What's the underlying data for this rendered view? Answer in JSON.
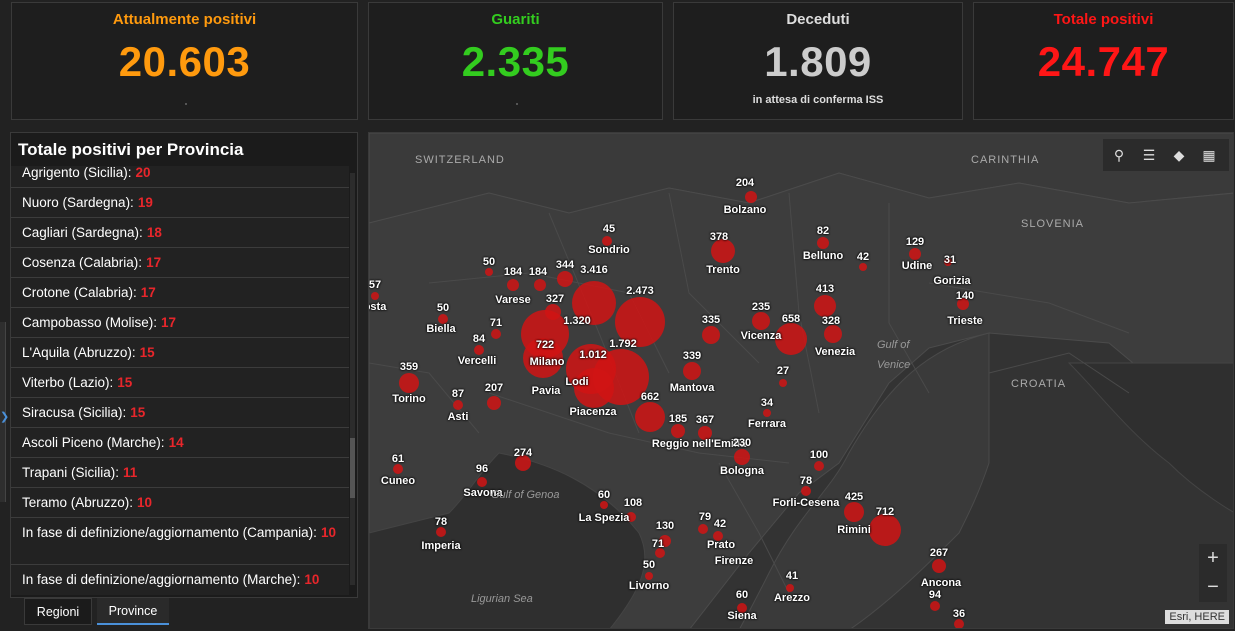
{
  "cards": {
    "active": {
      "title": "Attualmente positivi",
      "value": "20.603",
      "color": "#ff9a0e"
    },
    "recovered": {
      "title": "Guariti",
      "value": "2.335",
      "color": "#33cc1f"
    },
    "deceased": {
      "title": "Deceduti",
      "value": "1.809",
      "note": "in attesa di conferma ISS",
      "color": "#cccccc"
    },
    "total": {
      "title": "Totale positivi",
      "value": "24.747",
      "color": "#ff1616"
    }
  },
  "panel": {
    "title": "Totale positivi per Provincia",
    "rows": [
      {
        "label": "Agrigento (Sicilia):",
        "value": "20"
      },
      {
        "label": "Nuoro (Sardegna):",
        "value": "19"
      },
      {
        "label": "Cagliari (Sardegna):",
        "value": "18"
      },
      {
        "label": "Cosenza (Calabria):",
        "value": "17"
      },
      {
        "label": "Crotone (Calabria):",
        "value": "17"
      },
      {
        "label": "Campobasso (Molise):",
        "value": "17"
      },
      {
        "label": "L'Aquila (Abruzzo):",
        "value": "15"
      },
      {
        "label": "Viterbo (Lazio):",
        "value": "15"
      },
      {
        "label": "Siracusa (Sicilia):",
        "value": "15"
      },
      {
        "label": "Ascoli Piceno (Marche):",
        "value": "14"
      },
      {
        "label": "Trapani (Sicilia):",
        "value": "11"
      },
      {
        "label": "Teramo (Abruzzo):",
        "value": "10"
      },
      {
        "label": "In fase di definizione/aggiornamento (Campania):",
        "value": "10"
      },
      {
        "label": "In fase di definizione/aggiornamento (Marche):",
        "value": "10"
      }
    ]
  },
  "tabs": [
    "Regioni",
    "Province"
  ],
  "map": {
    "regions": [
      "SWITZERLAND",
      "CARINTHIA",
      "SLOVENIA",
      "CROATIA"
    ],
    "seas": [
      "Gulf of",
      "Venice",
      "Gulf of Genoa",
      "Ligurian Sea"
    ],
    "attribution": "Esri, HERE",
    "marker_color": "#d01414",
    "points": [
      {
        "value": "204",
        "name": "Bolzano"
      },
      {
        "value": "45",
        "name": "Sondrio"
      },
      {
        "value": "378",
        "name": "Trento"
      },
      {
        "value": "82",
        "name": "Belluno"
      },
      {
        "value": "42",
        "name": ""
      },
      {
        "value": "129",
        "name": "Udine"
      },
      {
        "value": "31",
        "name": "Gorizia"
      },
      {
        "value": "140",
        "name": "Trieste"
      },
      {
        "value": "50",
        "name": ""
      },
      {
        "value": "184",
        "name": "Varese"
      },
      {
        "value": "184",
        "name": ""
      },
      {
        "value": "344",
        "name": ""
      },
      {
        "value": "3.416",
        "name": ""
      },
      {
        "value": "2.473",
        "name": ""
      },
      {
        "value": "57",
        "name": "osta"
      },
      {
        "value": "50",
        "name": "Biella"
      },
      {
        "value": "71",
        "name": ""
      },
      {
        "value": "327",
        "name": ""
      },
      {
        "value": "1.320",
        "name": ""
      },
      {
        "value": "84",
        "name": "Vercelli"
      },
      {
        "value": "722",
        "name": "Milano"
      },
      {
        "value": "1.792",
        "name": ""
      },
      {
        "value": "1.012",
        "name": "Lodi"
      },
      {
        "value": "335",
        "name": ""
      },
      {
        "value": "235",
        "name": "Vicenza"
      },
      {
        "value": "658",
        "name": ""
      },
      {
        "value": "413",
        "name": ""
      },
      {
        "value": "328",
        "name": "Venezia"
      },
      {
        "value": "359",
        "name": "Torino"
      },
      {
        "value": "87",
        "name": "Asti"
      },
      {
        "value": "207",
        "name": ""
      },
      {
        "value": "",
        "name": "Pavia"
      },
      {
        "value": "",
        "name": "Piacenza"
      },
      {
        "value": "339",
        "name": "Mantova"
      },
      {
        "value": "27",
        "name": ""
      },
      {
        "value": "662",
        "name": ""
      },
      {
        "value": "185",
        "name": "Reggio nell'Emilia"
      },
      {
        "value": "367",
        "name": ""
      },
      {
        "value": "34",
        "name": "Ferrara"
      },
      {
        "value": "230",
        "name": "Bologna"
      },
      {
        "value": "61",
        "name": "Cuneo"
      },
      {
        "value": "96",
        "name": "Savona"
      },
      {
        "value": "274",
        "name": ""
      },
      {
        "value": "100",
        "name": ""
      },
      {
        "value": "78",
        "name": "Forli-Cesena"
      },
      {
        "value": "425",
        "name": "Rimini"
      },
      {
        "value": "712",
        "name": ""
      },
      {
        "value": "60",
        "name": "La Spezia"
      },
      {
        "value": "108",
        "name": ""
      },
      {
        "value": "78",
        "name": "Imperia"
      },
      {
        "value": "130",
        "name": ""
      },
      {
        "value": "79",
        "name": "Prato"
      },
      {
        "value": "42",
        "name": "Firenze"
      },
      {
        "value": "71",
        "name": ""
      },
      {
        "value": "50",
        "name": "Livorno"
      },
      {
        "value": "267",
        "name": "Ancona"
      },
      {
        "value": "94",
        "name": ""
      },
      {
        "value": "41",
        "name": "Arezzo"
      },
      {
        "value": "60",
        "name": "Siena"
      },
      {
        "value": "36",
        "name": ""
      }
    ]
  }
}
